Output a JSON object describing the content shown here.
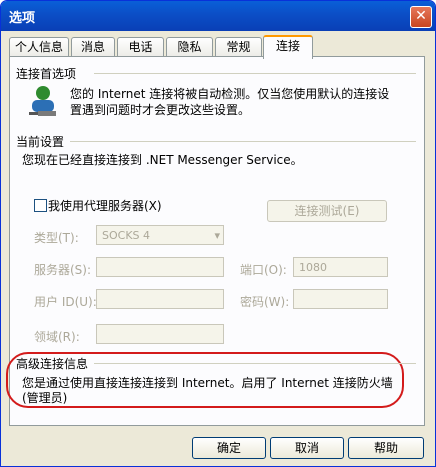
{
  "window": {
    "title": "选项",
    "close_icon": "close-icon"
  },
  "tabs": [
    {
      "label": "个人信息"
    },
    {
      "label": "消息"
    },
    {
      "label": "电话"
    },
    {
      "label": "隐私"
    },
    {
      "label": "常规"
    },
    {
      "label": "连接"
    }
  ],
  "active_tab": "连接",
  "connection_prefs": {
    "heading": "连接首选项",
    "line1": "您的 Internet 连接将被自动检测。仅当您使用默认的连接设",
    "line2": "置遇到问题时才会更改这些设置。"
  },
  "current_settings": {
    "heading": "当前设置",
    "text": "您现在已经直接连接到 .NET Messenger Service。"
  },
  "proxy": {
    "checkbox_label": "我使用代理服务器(X)",
    "test_button": "连接测试(E)",
    "type_label": "类型(T):",
    "type_value": "SOCKS 4",
    "server_label": "服务器(S):",
    "port_label": "端口(O):",
    "port_value": "1080",
    "userid_label": "用户 ID(U):",
    "password_label": "密码(W):",
    "domain_label": "领域(R):"
  },
  "advanced": {
    "heading": "高级连接信息",
    "line1": "您是通过使用直接连接连接到 Internet。启用了 Internet 连接防火墙",
    "line2": "(管理员)"
  },
  "footer": {
    "ok": "确定",
    "cancel": "取消",
    "help": "帮助"
  }
}
